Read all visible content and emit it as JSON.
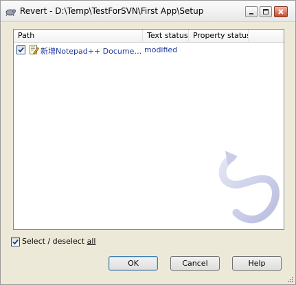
{
  "window": {
    "title": "Revert - D:\\Temp\\TestForSVN\\First App\\Setup"
  },
  "list": {
    "columns": [
      "Path",
      "Text status",
      "Property status"
    ],
    "rows": [
      {
        "checked": true,
        "path": "新增Notepad++ Documen...",
        "text_status": "modified",
        "property_status": "",
        "icon": "text-document-icon"
      }
    ]
  },
  "select_all": {
    "label_before": "Select / deselect ",
    "label_underlined": "all",
    "checked": true
  },
  "buttons": {
    "ok": "OK",
    "cancel": "Cancel",
    "help": "Help"
  },
  "colors": {
    "accent": "#1f3a9a",
    "watermark": "#cfd3ea"
  }
}
